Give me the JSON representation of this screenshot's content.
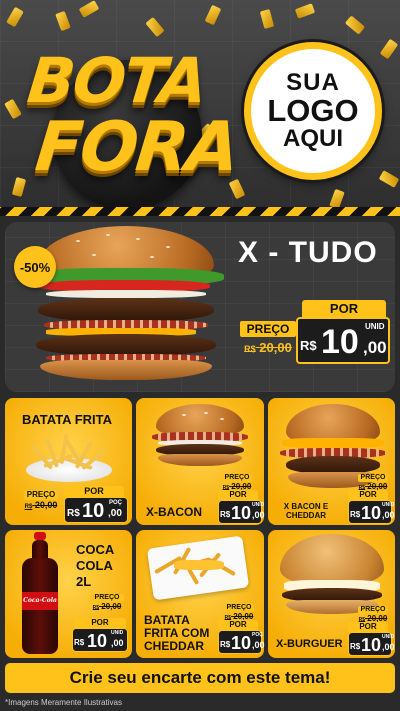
{
  "header": {
    "title_line1": "BOTA",
    "title_line2": "FORA",
    "logo_line1": "SUA",
    "logo_line2": "LOGO",
    "logo_line3": "AQUI"
  },
  "featured": {
    "discount": "-50%",
    "name": "X - TUDO",
    "por_label": "POR",
    "preco_label": "PREÇO",
    "old_currency": "R$",
    "old_price": "20,00",
    "currency": "R$",
    "price_int": "10",
    "price_dec": ",00",
    "unit": "UNID"
  },
  "products": [
    {
      "name": "BATATA FRITA",
      "preco_label": "PREÇO",
      "old_currency": "R$",
      "old_price": "20,00",
      "por_label": "POR",
      "currency": "R$",
      "price_int": "10",
      "price_dec": ",00",
      "unit": "POÇ"
    },
    {
      "name": "X-BACON",
      "preco_label": "PREÇO",
      "old_currency": "R$",
      "old_price": "20,00",
      "por_label": "POR",
      "currency": "R$",
      "price_int": "10",
      "price_dec": ",00",
      "unit": "UNID"
    },
    {
      "name_line1": "X BACON E",
      "name_line2": "CHEDDAR",
      "preco_label": "PREÇO",
      "old_currency": "R$",
      "old_price": "20,00",
      "por_label": "POR",
      "currency": "R$",
      "price_int": "10",
      "price_dec": ",00",
      "unit": "UNID"
    },
    {
      "name_line1": "COCA",
      "name_line2": "COLA",
      "name_line3": "2L",
      "preco_label": "PREÇO",
      "old_currency": "R$",
      "old_price": "20,00",
      "por_label": "POR",
      "currency": "R$",
      "price_int": "10",
      "price_dec": ",00",
      "unit": "UNID"
    },
    {
      "name_line1": "BATATA",
      "name_line2": "FRITA COM",
      "name_line3": "CHEDDAR",
      "preco_label": "PREÇO",
      "old_currency": "R$",
      "old_price": "20,00",
      "por_label": "POR",
      "currency": "R$",
      "price_int": "10",
      "price_dec": ",00",
      "unit": "POÇ"
    },
    {
      "name": "X-BURGUER",
      "preco_label": "PREÇO",
      "old_currency": "R$",
      "old_price": "20,00",
      "por_label": "POR",
      "currency": "R$",
      "price_int": "10",
      "price_dec": ",00",
      "unit": "UNID"
    }
  ],
  "bottle_brand": "Coca-Cola",
  "footer": {
    "cta": "Crie seu encarte com este tema!",
    "disclaimer": "*Imagens Meramente Ilustrativas"
  },
  "colors": {
    "accent": "#ffc21a",
    "dark": "#1c1c1c",
    "background": "#2a2a2a"
  }
}
